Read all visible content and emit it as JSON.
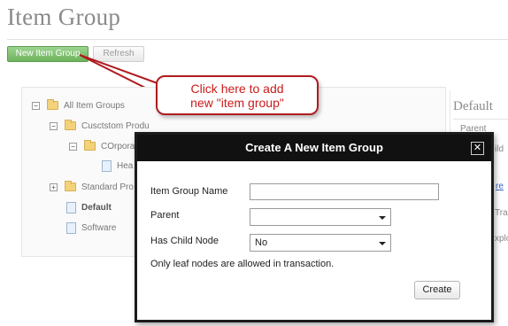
{
  "page": {
    "title": "Item Group"
  },
  "toolbar": {
    "new_label": "New Item Group",
    "refresh_label": "Refresh"
  },
  "tree": {
    "root": "All Item Groups",
    "child1": "Cusctstom Produ",
    "child1_1": "COrpora",
    "child1_1_1": "Hea",
    "child2": "Standard Pro",
    "default": "Default",
    "software": "Software"
  },
  "right_panel": {
    "title": "Default",
    "parent_label": "Parent",
    "child_label": "ild",
    "link_text": "re",
    "tra_text": "Tra",
    "explore_text": "xplo"
  },
  "callout": {
    "line1": "Click here to add",
    "line2": "new \"item group\""
  },
  "dialog": {
    "title": "Create A New Item Group",
    "close_glyph": "✕",
    "fields": {
      "name_label": "Item Group Name",
      "name_value": "",
      "parent_label": "Parent",
      "parent_value": "",
      "child_label": "Has Child Node",
      "child_value": "No"
    },
    "note": "Only leaf nodes are allowed in transaction.",
    "create_label": "Create"
  },
  "colors": {
    "accent_green": "#6db35c",
    "callout_red": "#b01c20",
    "dialog_header": "#111111"
  }
}
